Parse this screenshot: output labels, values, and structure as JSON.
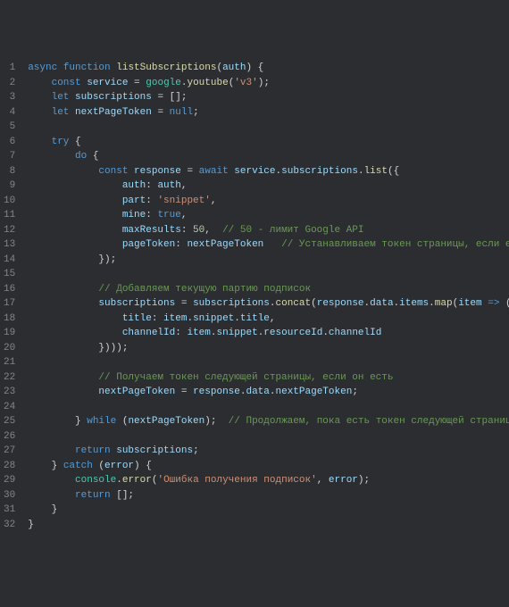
{
  "language": "javascript",
  "theme": "dark-plus",
  "gutter": {
    "start": 1,
    "end": 32
  },
  "code": {
    "lines": [
      {
        "n": 1,
        "tokens": [
          [
            "kw",
            "async"
          ],
          [
            "pn",
            " "
          ],
          [
            "kw",
            "function"
          ],
          [
            "pn",
            " "
          ],
          [
            "fn",
            "listSubscriptions"
          ],
          [
            "pn",
            "("
          ],
          [
            "pm",
            "auth"
          ],
          [
            "pn",
            ") {"
          ]
        ]
      },
      {
        "n": 2,
        "indent": 4,
        "tokens": [
          [
            "kw",
            "const"
          ],
          [
            "pn",
            " "
          ],
          [
            "id",
            "service"
          ],
          [
            "pn",
            " = "
          ],
          [
            "cls",
            "google"
          ],
          [
            "pn",
            "."
          ],
          [
            "fn",
            "youtube"
          ],
          [
            "pn",
            "("
          ],
          [
            "str",
            "'v3'"
          ],
          [
            "pn",
            ");"
          ]
        ]
      },
      {
        "n": 3,
        "indent": 4,
        "tokens": [
          [
            "kw",
            "let"
          ],
          [
            "pn",
            " "
          ],
          [
            "id",
            "subscriptions"
          ],
          [
            "pn",
            " = [];"
          ]
        ]
      },
      {
        "n": 4,
        "indent": 4,
        "tokens": [
          [
            "kw",
            "let"
          ],
          [
            "pn",
            " "
          ],
          [
            "id",
            "nextPageToken"
          ],
          [
            "pn",
            " = "
          ],
          [
            "kw",
            "null"
          ],
          [
            "pn",
            ";"
          ]
        ]
      },
      {
        "n": 5,
        "tokens": []
      },
      {
        "n": 6,
        "indent": 4,
        "tokens": [
          [
            "kw",
            "try"
          ],
          [
            "pn",
            " {"
          ]
        ]
      },
      {
        "n": 7,
        "indent": 8,
        "tokens": [
          [
            "kw",
            "do"
          ],
          [
            "pn",
            " {"
          ]
        ]
      },
      {
        "n": 8,
        "indent": 12,
        "tokens": [
          [
            "kw",
            "const"
          ],
          [
            "pn",
            " "
          ],
          [
            "id",
            "response"
          ],
          [
            "pn",
            " = "
          ],
          [
            "kw",
            "await"
          ],
          [
            "pn",
            " "
          ],
          [
            "id",
            "service"
          ],
          [
            "pn",
            "."
          ],
          [
            "id",
            "subscriptions"
          ],
          [
            "pn",
            "."
          ],
          [
            "fn",
            "list"
          ],
          [
            "pn",
            "({"
          ]
        ]
      },
      {
        "n": 9,
        "indent": 16,
        "tokens": [
          [
            "pr",
            "auth"
          ],
          [
            "pn",
            ": "
          ],
          [
            "id",
            "auth"
          ],
          [
            "pn",
            ","
          ]
        ]
      },
      {
        "n": 10,
        "indent": 16,
        "tokens": [
          [
            "pr",
            "part"
          ],
          [
            "pn",
            ": "
          ],
          [
            "str",
            "'snippet'"
          ],
          [
            "pn",
            ","
          ]
        ]
      },
      {
        "n": 11,
        "indent": 16,
        "tokens": [
          [
            "pr",
            "mine"
          ],
          [
            "pn",
            ": "
          ],
          [
            "kw",
            "true"
          ],
          [
            "pn",
            ","
          ]
        ]
      },
      {
        "n": 12,
        "indent": 16,
        "tokens": [
          [
            "pr",
            "maxResults"
          ],
          [
            "pn",
            ": "
          ],
          [
            "num",
            "50"
          ],
          [
            "pn",
            ",  "
          ],
          [
            "cmt",
            "// 50 - лимит Google API"
          ]
        ]
      },
      {
        "n": 13,
        "indent": 16,
        "tokens": [
          [
            "pr",
            "pageToken"
          ],
          [
            "pn",
            ": "
          ],
          [
            "id",
            "nextPageToken"
          ],
          [
            "pn",
            "   "
          ],
          [
            "cmt",
            "// Устанавливаем токен страницы, если есть"
          ]
        ]
      },
      {
        "n": 14,
        "indent": 12,
        "tokens": [
          [
            "pn",
            "});"
          ]
        ]
      },
      {
        "n": 15,
        "tokens": []
      },
      {
        "n": 16,
        "indent": 12,
        "tokens": [
          [
            "cmt",
            "// Добавляем текущую партию подписок"
          ]
        ]
      },
      {
        "n": 17,
        "indent": 12,
        "tokens": [
          [
            "id",
            "subscriptions"
          ],
          [
            "pn",
            " = "
          ],
          [
            "id",
            "subscriptions"
          ],
          [
            "pn",
            "."
          ],
          [
            "fn",
            "concat"
          ],
          [
            "pn",
            "("
          ],
          [
            "id",
            "response"
          ],
          [
            "pn",
            "."
          ],
          [
            "id",
            "data"
          ],
          [
            "pn",
            "."
          ],
          [
            "id",
            "items"
          ],
          [
            "pn",
            "."
          ],
          [
            "fn",
            "map"
          ],
          [
            "pn",
            "("
          ],
          [
            "pm",
            "item"
          ],
          [
            "pn",
            " "
          ],
          [
            "kw",
            "=>"
          ],
          [
            "pn",
            " ({"
          ]
        ]
      },
      {
        "n": 18,
        "indent": 16,
        "tokens": [
          [
            "pr",
            "title"
          ],
          [
            "pn",
            ": "
          ],
          [
            "id",
            "item"
          ],
          [
            "pn",
            "."
          ],
          [
            "id",
            "snippet"
          ],
          [
            "pn",
            "."
          ],
          [
            "id",
            "title"
          ],
          [
            "pn",
            ","
          ]
        ]
      },
      {
        "n": 19,
        "indent": 16,
        "tokens": [
          [
            "pr",
            "channelId"
          ],
          [
            "pn",
            ": "
          ],
          [
            "id",
            "item"
          ],
          [
            "pn",
            "."
          ],
          [
            "id",
            "snippet"
          ],
          [
            "pn",
            "."
          ],
          [
            "id",
            "resourceId"
          ],
          [
            "pn",
            "."
          ],
          [
            "id",
            "channelId"
          ]
        ]
      },
      {
        "n": 20,
        "indent": 12,
        "tokens": [
          [
            "pn",
            "})));"
          ]
        ]
      },
      {
        "n": 21,
        "tokens": []
      },
      {
        "n": 22,
        "indent": 12,
        "tokens": [
          [
            "cmt",
            "// Получаем токен следующей страницы, если он есть"
          ]
        ]
      },
      {
        "n": 23,
        "indent": 12,
        "tokens": [
          [
            "id",
            "nextPageToken"
          ],
          [
            "pn",
            " = "
          ],
          [
            "id",
            "response"
          ],
          [
            "pn",
            "."
          ],
          [
            "id",
            "data"
          ],
          [
            "pn",
            "."
          ],
          [
            "id",
            "nextPageToken"
          ],
          [
            "pn",
            ";"
          ]
        ]
      },
      {
        "n": 24,
        "tokens": []
      },
      {
        "n": 25,
        "indent": 8,
        "tokens": [
          [
            "pn",
            "} "
          ],
          [
            "kw",
            "while"
          ],
          [
            "pn",
            " ("
          ],
          [
            "id",
            "nextPageToken"
          ],
          [
            "pn",
            ");  "
          ],
          [
            "cmt",
            "// Продолжаем, пока есть токен следующей страницы"
          ]
        ]
      },
      {
        "n": 26,
        "tokens": []
      },
      {
        "n": 27,
        "indent": 8,
        "tokens": [
          [
            "kw",
            "return"
          ],
          [
            "pn",
            " "
          ],
          [
            "id",
            "subscriptions"
          ],
          [
            "pn",
            ";"
          ]
        ]
      },
      {
        "n": 28,
        "indent": 4,
        "tokens": [
          [
            "pn",
            "} "
          ],
          [
            "kw",
            "catch"
          ],
          [
            "pn",
            " ("
          ],
          [
            "pm",
            "error"
          ],
          [
            "pn",
            ") {"
          ]
        ]
      },
      {
        "n": 29,
        "indent": 8,
        "tokens": [
          [
            "cls",
            "console"
          ],
          [
            "pn",
            "."
          ],
          [
            "fn",
            "error"
          ],
          [
            "pn",
            "("
          ],
          [
            "str",
            "'Ошибка получения подписок'"
          ],
          [
            "pn",
            ", "
          ],
          [
            "id",
            "error"
          ],
          [
            "pn",
            ");"
          ]
        ]
      },
      {
        "n": 30,
        "indent": 8,
        "tokens": [
          [
            "kw",
            "return"
          ],
          [
            "pn",
            " [];"
          ]
        ]
      },
      {
        "n": 31,
        "indent": 4,
        "tokens": [
          [
            "pn",
            "}"
          ]
        ]
      },
      {
        "n": 32,
        "tokens": [
          [
            "pn",
            "}"
          ]
        ]
      }
    ]
  }
}
